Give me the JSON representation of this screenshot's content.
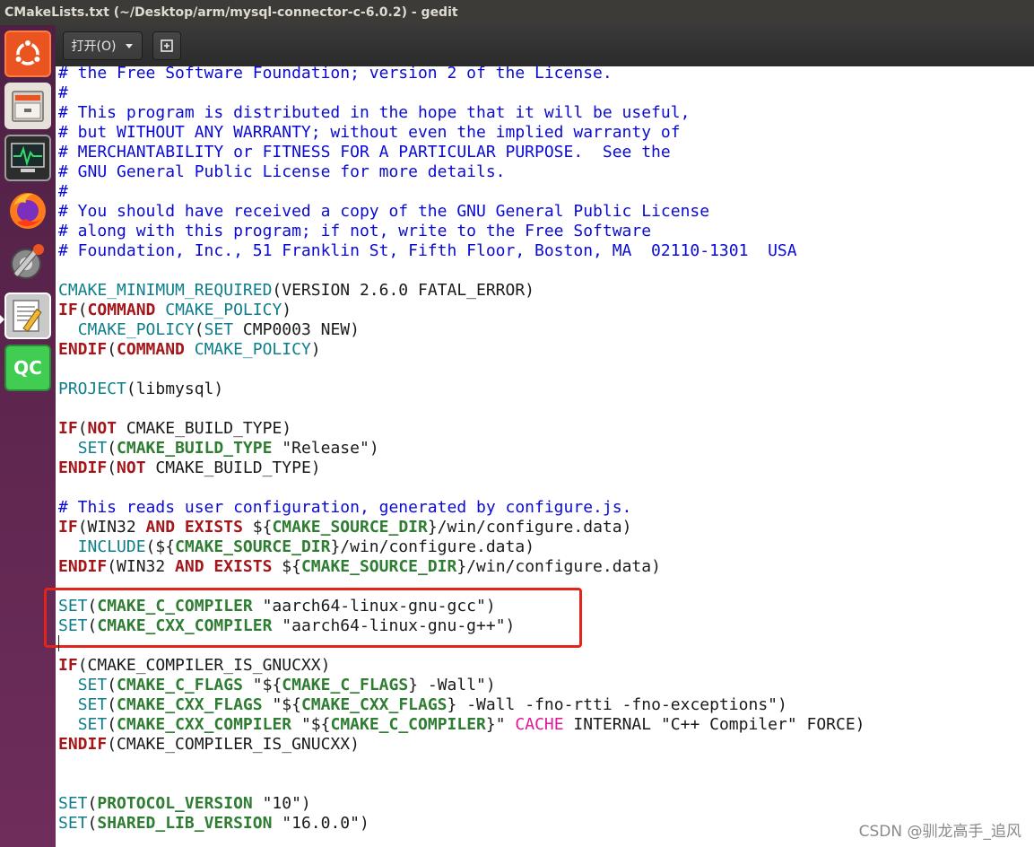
{
  "window": {
    "title": "CMakeLists.txt (~/Desktop/arm/mysql-connector-c-6.0.2) - gedit"
  },
  "launcher": {
    "items": [
      {
        "name": "ubuntu-dash",
        "icon": "ubuntu-logo-icon",
        "color": "#dd4814"
      },
      {
        "name": "files",
        "icon": "file-cabinet-icon",
        "color": "#d9d5cf"
      },
      {
        "name": "system-monitor",
        "icon": "system-monitor-icon",
        "color": "#3b3b3b"
      },
      {
        "name": "firefox",
        "icon": "firefox-icon",
        "color": "#ff6611"
      },
      {
        "name": "system-settings",
        "icon": "settings-wrench-icon",
        "color": "#7a7a7a"
      },
      {
        "name": "text-editor",
        "icon": "text-editor-icon",
        "color": "#e8e8e8"
      },
      {
        "name": "qt-creator",
        "icon": "qt-creator-icon",
        "color": "#41cd52",
        "label": "QC"
      }
    ]
  },
  "toolbar": {
    "open_label": "打开(O)",
    "open_dropdown_icon": "chevron-down-icon",
    "new_document_icon": "new-document-icon"
  },
  "editor": {
    "lines": [
      [
        {
          "t": "comment",
          "v": "# the Free Software Foundation; version 2 of the License."
        }
      ],
      [
        {
          "t": "comment",
          "v": "#"
        }
      ],
      [
        {
          "t": "comment",
          "v": "# This program is distributed in the hope that it will be useful,"
        }
      ],
      [
        {
          "t": "comment",
          "v": "# but WITHOUT ANY WARRANTY; without even the implied warranty of"
        }
      ],
      [
        {
          "t": "comment",
          "v": "# MERCHANTABILITY or FITNESS FOR A PARTICULAR PURPOSE.  See the"
        }
      ],
      [
        {
          "t": "comment",
          "v": "# GNU General Public License for more details."
        }
      ],
      [
        {
          "t": "comment",
          "v": "#"
        }
      ],
      [
        {
          "t": "comment",
          "v": "# You should have received a copy of the GNU General Public License"
        }
      ],
      [
        {
          "t": "comment",
          "v": "# along with this program; if not, write to the Free Software"
        }
      ],
      [
        {
          "t": "comment",
          "v": "# Foundation, Inc., 51 Franklin St, Fifth Floor, Boston, MA  02110-1301  USA"
        }
      ],
      [],
      [
        {
          "t": "func",
          "v": "CMAKE_MINIMUM_REQUIRED"
        },
        {
          "t": "plain",
          "v": "(VERSION 2.6.0 FATAL_ERROR)"
        }
      ],
      [
        {
          "t": "kw",
          "v": "IF"
        },
        {
          "t": "plain",
          "v": "("
        },
        {
          "t": "kw",
          "v": "COMMAND"
        },
        {
          "t": "plain",
          "v": " "
        },
        {
          "t": "func",
          "v": "CMAKE_POLICY"
        },
        {
          "t": "plain",
          "v": ")"
        }
      ],
      [
        {
          "t": "plain",
          "v": "  "
        },
        {
          "t": "func",
          "v": "CMAKE_POLICY"
        },
        {
          "t": "plain",
          "v": "("
        },
        {
          "t": "func",
          "v": "SET"
        },
        {
          "t": "plain",
          "v": " CMP0003 NEW)"
        }
      ],
      [
        {
          "t": "kw",
          "v": "ENDIF"
        },
        {
          "t": "plain",
          "v": "("
        },
        {
          "t": "kw",
          "v": "COMMAND"
        },
        {
          "t": "plain",
          "v": " "
        },
        {
          "t": "func",
          "v": "CMAKE_POLICY"
        },
        {
          "t": "plain",
          "v": ")"
        }
      ],
      [],
      [
        {
          "t": "func",
          "v": "PROJECT"
        },
        {
          "t": "plain",
          "v": "(libmysql)"
        }
      ],
      [],
      [
        {
          "t": "kw",
          "v": "IF"
        },
        {
          "t": "plain",
          "v": "("
        },
        {
          "t": "kw",
          "v": "NOT"
        },
        {
          "t": "plain",
          "v": " CMAKE_BUILD_TYPE)"
        }
      ],
      [
        {
          "t": "plain",
          "v": "  "
        },
        {
          "t": "func",
          "v": "SET"
        },
        {
          "t": "plain",
          "v": "("
        },
        {
          "t": "var",
          "v": "CMAKE_BUILD_TYPE"
        },
        {
          "t": "plain",
          "v": " "
        },
        {
          "t": "str",
          "v": "\"Release\""
        },
        {
          "t": "plain",
          "v": ")"
        }
      ],
      [
        {
          "t": "kw",
          "v": "ENDIF"
        },
        {
          "t": "plain",
          "v": "("
        },
        {
          "t": "kw",
          "v": "NOT"
        },
        {
          "t": "plain",
          "v": " CMAKE_BUILD_TYPE)"
        }
      ],
      [],
      [
        {
          "t": "comment",
          "v": "# This reads user configuration, generated by configure.js."
        }
      ],
      [
        {
          "t": "kw",
          "v": "IF"
        },
        {
          "t": "plain",
          "v": "(WIN32 "
        },
        {
          "t": "kw",
          "v": "AND"
        },
        {
          "t": "plain",
          "v": " "
        },
        {
          "t": "kw",
          "v": "EXISTS"
        },
        {
          "t": "plain",
          "v": " ${"
        },
        {
          "t": "var",
          "v": "CMAKE_SOURCE_DIR"
        },
        {
          "t": "plain",
          "v": "}/win/configure.data)"
        }
      ],
      [
        {
          "t": "plain",
          "v": "  "
        },
        {
          "t": "func",
          "v": "INCLUDE"
        },
        {
          "t": "plain",
          "v": "(${"
        },
        {
          "t": "var",
          "v": "CMAKE_SOURCE_DIR"
        },
        {
          "t": "plain",
          "v": "}/win/configure.data)"
        }
      ],
      [
        {
          "t": "kw",
          "v": "ENDIF"
        },
        {
          "t": "plain",
          "v": "(WIN32 "
        },
        {
          "t": "kw",
          "v": "AND"
        },
        {
          "t": "plain",
          "v": " "
        },
        {
          "t": "kw",
          "v": "EXISTS"
        },
        {
          "t": "plain",
          "v": " ${"
        },
        {
          "t": "var",
          "v": "CMAKE_SOURCE_DIR"
        },
        {
          "t": "plain",
          "v": "}/win/configure.data)"
        }
      ],
      [],
      [
        {
          "t": "func",
          "v": "SET"
        },
        {
          "t": "plain",
          "v": "("
        },
        {
          "t": "var",
          "v": "CMAKE_C_COMPILER"
        },
        {
          "t": "plain",
          "v": " "
        },
        {
          "t": "str",
          "v": "\"aarch64-linux-gnu-gcc\""
        },
        {
          "t": "plain",
          "v": ")"
        }
      ],
      [
        {
          "t": "func",
          "v": "SET"
        },
        {
          "t": "plain",
          "v": "("
        },
        {
          "t": "var",
          "v": "CMAKE_CXX_COMPILER"
        },
        {
          "t": "plain",
          "v": " "
        },
        {
          "t": "str",
          "v": "\"aarch64-linux-gnu-g++\""
        },
        {
          "t": "plain",
          "v": ")"
        }
      ],
      [],
      [
        {
          "t": "kw",
          "v": "IF"
        },
        {
          "t": "plain",
          "v": "(CMAKE_COMPILER_IS_GNUCXX)"
        }
      ],
      [
        {
          "t": "plain",
          "v": "  "
        },
        {
          "t": "func",
          "v": "SET"
        },
        {
          "t": "plain",
          "v": "("
        },
        {
          "t": "var",
          "v": "CMAKE_C_FLAGS"
        },
        {
          "t": "plain",
          "v": " \"${"
        },
        {
          "t": "var",
          "v": "CMAKE_C_FLAGS"
        },
        {
          "t": "plain",
          "v": "} -Wall\")"
        }
      ],
      [
        {
          "t": "plain",
          "v": "  "
        },
        {
          "t": "func",
          "v": "SET"
        },
        {
          "t": "plain",
          "v": "("
        },
        {
          "t": "var",
          "v": "CMAKE_CXX_FLAGS"
        },
        {
          "t": "plain",
          "v": " \"${"
        },
        {
          "t": "var",
          "v": "CMAKE_CXX_FLAGS"
        },
        {
          "t": "plain",
          "v": "} -Wall -fno-rtti -fno-exceptions\")"
        }
      ],
      [
        {
          "t": "plain",
          "v": "  "
        },
        {
          "t": "func",
          "v": "SET"
        },
        {
          "t": "plain",
          "v": "("
        },
        {
          "t": "var",
          "v": "CMAKE_CXX_COMPILER"
        },
        {
          "t": "plain",
          "v": " \"${"
        },
        {
          "t": "var",
          "v": "CMAKE_C_COMPILER"
        },
        {
          "t": "plain",
          "v": "}\" "
        },
        {
          "t": "cache",
          "v": "CACHE"
        },
        {
          "t": "plain",
          "v": " INTERNAL \"C++ Compiler\" FORCE)"
        }
      ],
      [
        {
          "t": "kw",
          "v": "ENDIF"
        },
        {
          "t": "plain",
          "v": "(CMAKE_COMPILER_IS_GNUCXX)"
        }
      ],
      [],
      [],
      [
        {
          "t": "func",
          "v": "SET"
        },
        {
          "t": "plain",
          "v": "("
        },
        {
          "t": "var",
          "v": "PROTOCOL_VERSION"
        },
        {
          "t": "plain",
          "v": " \"10\")"
        }
      ],
      [
        {
          "t": "func",
          "v": "SET"
        },
        {
          "t": "plain",
          "v": "("
        },
        {
          "t": "var",
          "v": "SHARED_LIB_VERSION"
        },
        {
          "t": "plain",
          "v": " \"16.0.0\")"
        }
      ]
    ]
  },
  "annotation": {
    "color": "#e3241b"
  },
  "watermark": "CSDN @驯龙高手_追风",
  "colors": {
    "comment": "#0a0ad6",
    "function": "#0e7e8c",
    "keyword": "#a3161a",
    "variable": "#2e7d32",
    "cache": "#e0189a",
    "launcher": "#5e2750"
  }
}
